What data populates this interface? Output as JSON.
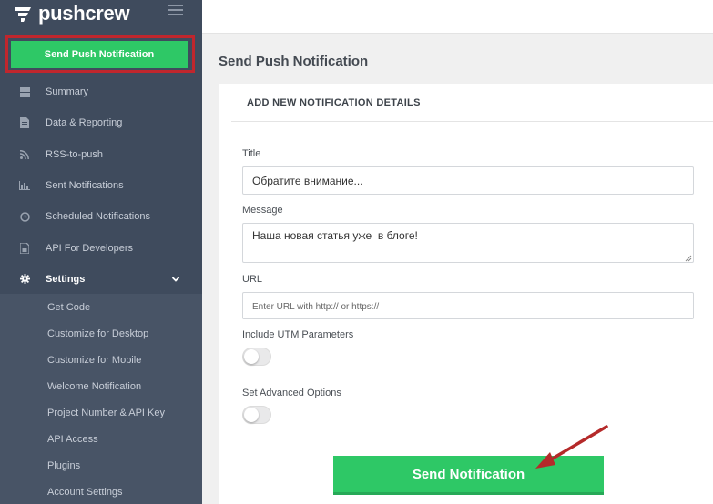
{
  "brand": {
    "name": "pushcrew"
  },
  "sidebar": {
    "cta_label": "Send Push Notification",
    "items": [
      {
        "label": "Summary",
        "icon": "dashboard-icon"
      },
      {
        "label": "Data & Reporting",
        "icon": "document-icon"
      },
      {
        "label": "RSS-to-push",
        "icon": "rss-icon"
      },
      {
        "label": "Sent Notifications",
        "icon": "bar-chart-icon"
      },
      {
        "label": "Scheduled Notifications",
        "icon": "clock-icon"
      },
      {
        "label": "API For Developers",
        "icon": "api-doc-icon"
      },
      {
        "label": "Settings",
        "icon": "gear-icon"
      }
    ],
    "settings_sub": [
      "Get Code",
      "Customize for Desktop",
      "Customize for Mobile",
      "Welcome Notification",
      "Project Number & API Key",
      "API Access",
      "Plugins",
      "Account Settings"
    ]
  },
  "main": {
    "page_title": "Send Push Notification",
    "card_header": "ADD NEW NOTIFICATION DETAILS",
    "title_label": "Title",
    "title_value": "Обратите внимание...",
    "message_label": "Message",
    "message_value": "Наша новая статья уже  в блоге!",
    "url_label": "URL",
    "url_placeholder": "Enter URL with http:// or https://",
    "utm_label": "Include UTM Parameters",
    "utm_enabled": false,
    "advanced_label": "Set Advanced Options",
    "advanced_enabled": false,
    "send_button": "Send Notification"
  },
  "colors": {
    "accent_green": "#2ec866",
    "sidebar_bg": "#3f4b5d",
    "highlight_red": "#c0262d"
  }
}
